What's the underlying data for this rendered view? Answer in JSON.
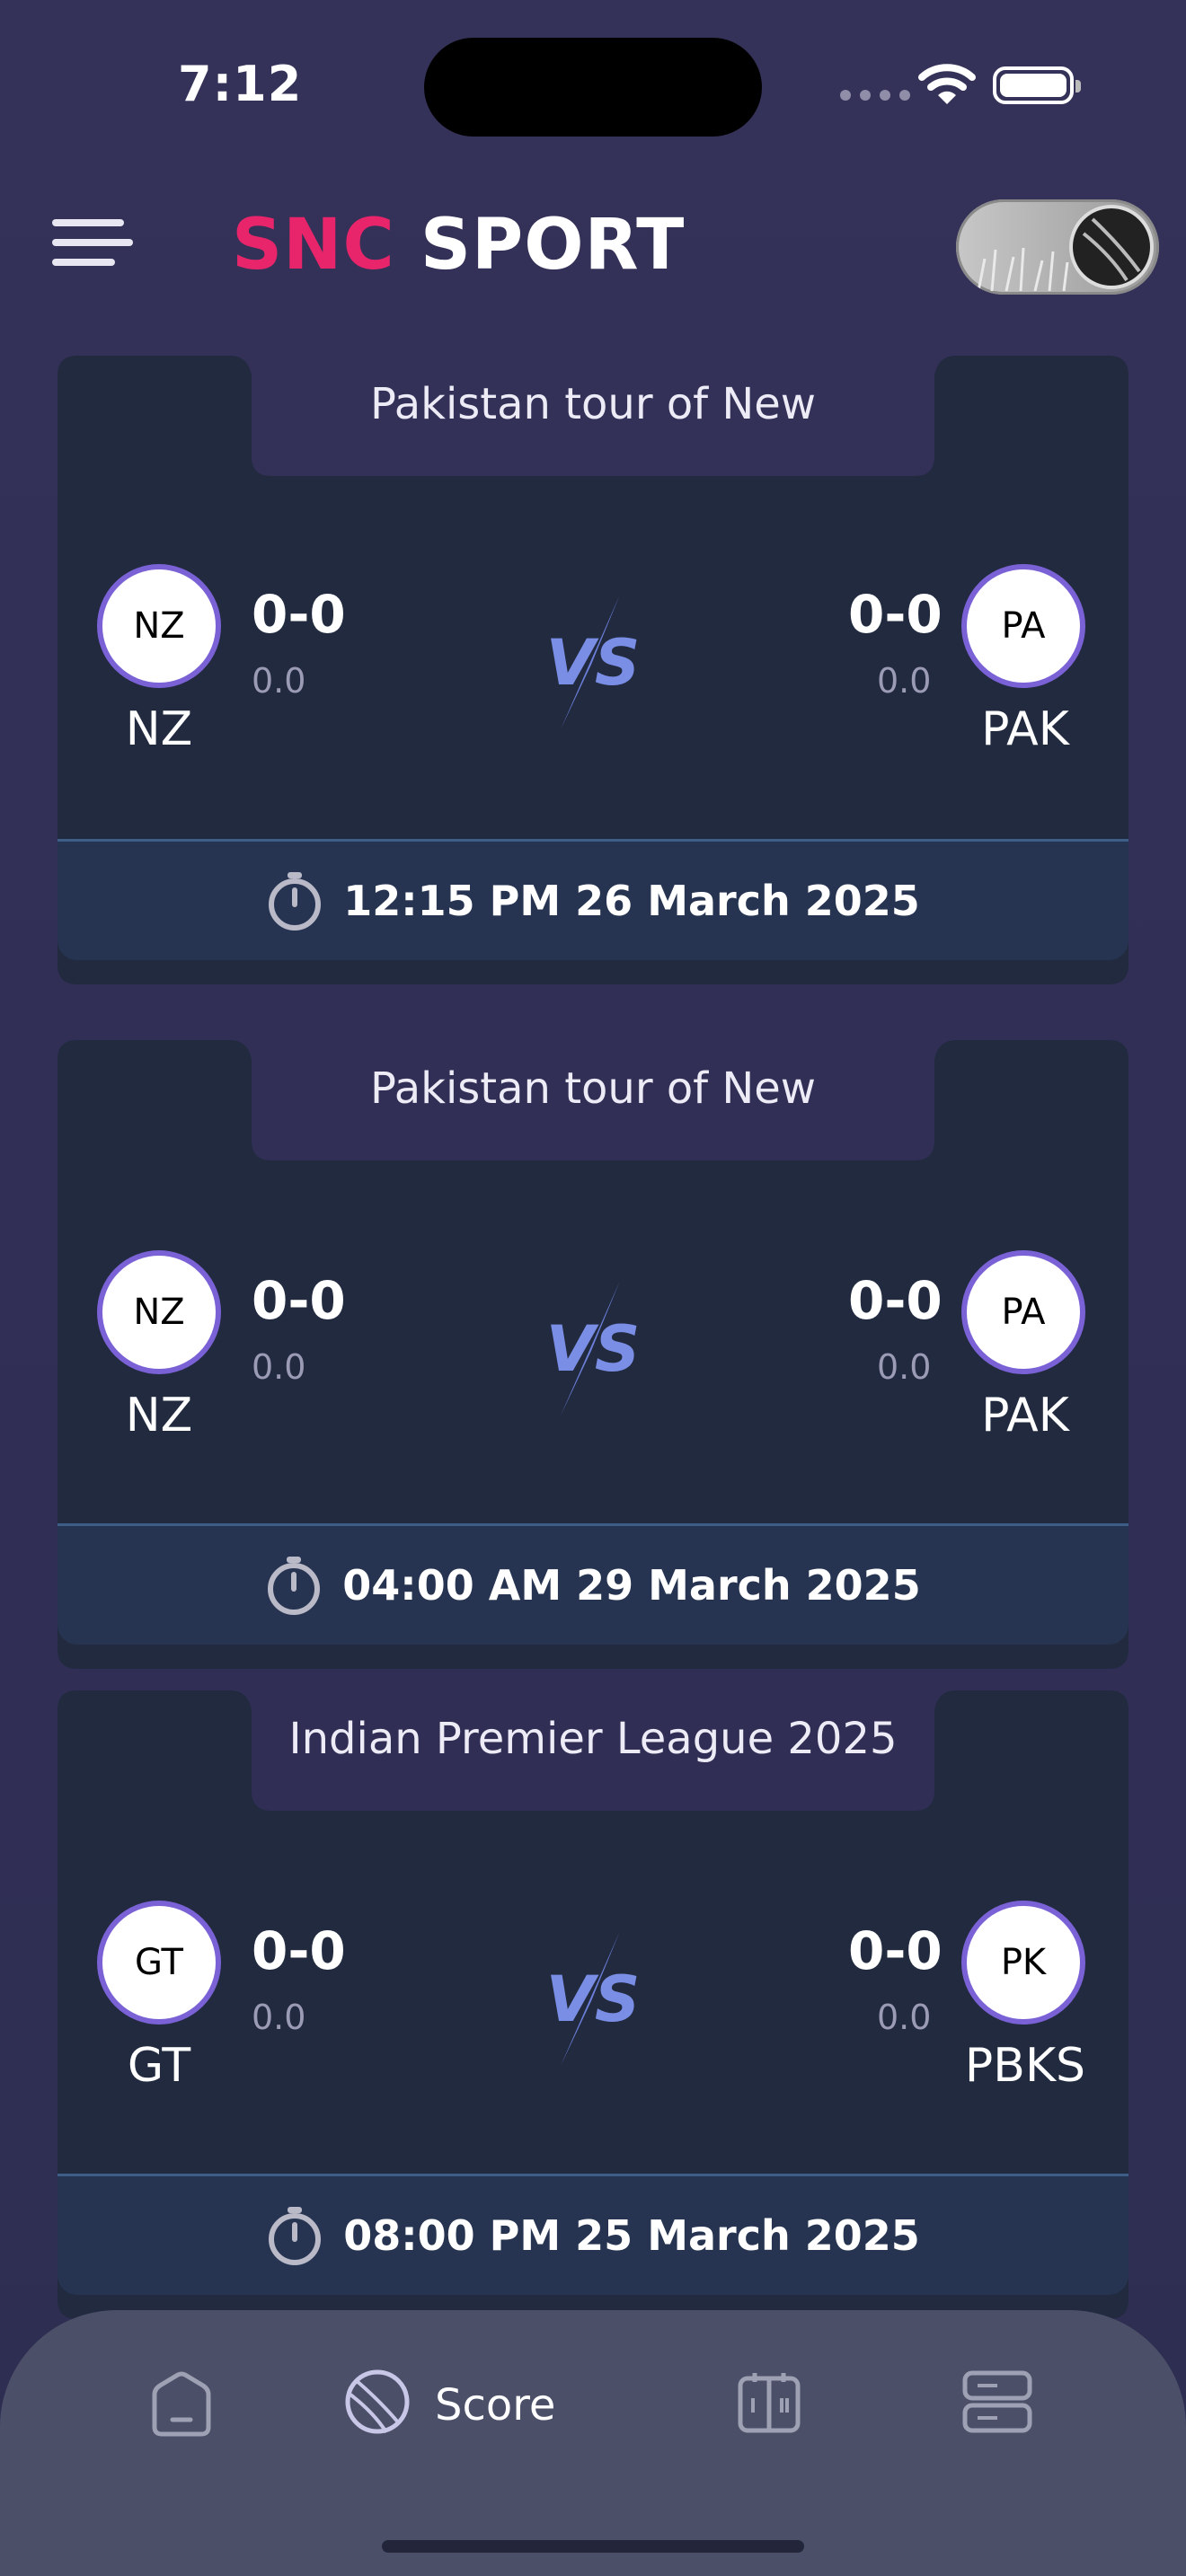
{
  "status_bar": {
    "time": "7:12"
  },
  "header": {
    "brand_accent": "SNC",
    "brand_main": "SPORT",
    "accent_color": "#e8256a"
  },
  "matches": [
    {
      "title": "Pakistan tour of New",
      "team1": {
        "logo": "NZ",
        "abbr": "NZ",
        "score": "0-0",
        "overs": "0.0"
      },
      "team2": {
        "logo": "PA",
        "abbr": "PAK",
        "score": "0-0",
        "overs": "0.0"
      },
      "datetime": "12:15 PM 26 March 2025"
    },
    {
      "title": "Pakistan tour of New",
      "team1": {
        "logo": "NZ",
        "abbr": "NZ",
        "score": "0-0",
        "overs": "0.0"
      },
      "team2": {
        "logo": "PA",
        "abbr": "PAK",
        "score": "0-0",
        "overs": "0.0"
      },
      "datetime": "04:00 AM 29 March 2025"
    },
    {
      "title": "Indian Premier League 2025",
      "team1": {
        "logo": "GT",
        "abbr": "GT",
        "score": "0-0",
        "overs": "0.0"
      },
      "team2": {
        "logo": "PK",
        "abbr": "PBKS",
        "score": "0-0",
        "overs": "0.0"
      },
      "datetime": "08:00 PM 25 March 2025"
    }
  ],
  "nav": {
    "items": [
      {
        "icon": "home-icon"
      },
      {
        "icon": "ball-icon",
        "label": "Score"
      },
      {
        "icon": "scoreboard-icon"
      },
      {
        "icon": "list-icon"
      }
    ]
  }
}
